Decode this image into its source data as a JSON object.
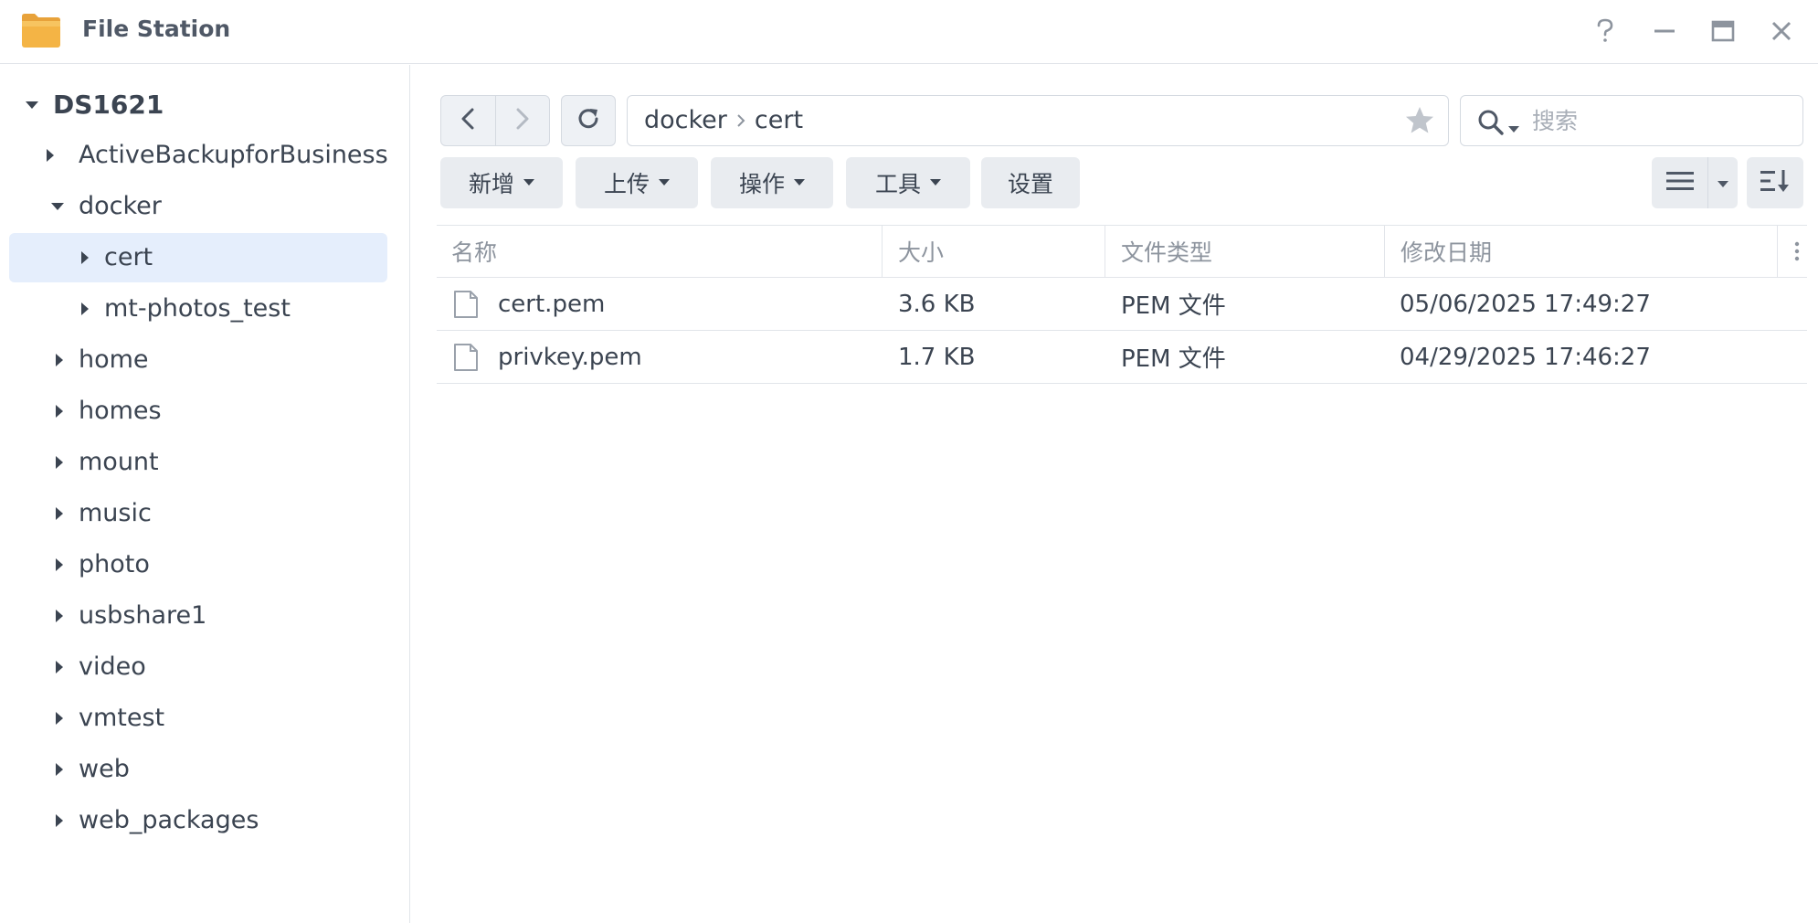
{
  "window": {
    "title": "File Station",
    "accent_color": "#e5eefc"
  },
  "sidebar": {
    "root": "DS1621",
    "items": [
      {
        "label": "ActiveBackupforBusiness",
        "expanded": false
      },
      {
        "label": "docker",
        "expanded": true
      },
      {
        "label": "cert",
        "expanded": false,
        "selected": true
      },
      {
        "label": "mt-photos_test",
        "expanded": false
      },
      {
        "label": "home",
        "expanded": false
      },
      {
        "label": "homes",
        "expanded": false
      },
      {
        "label": "mount",
        "expanded": false
      },
      {
        "label": "music",
        "expanded": false
      },
      {
        "label": "photo",
        "expanded": false
      },
      {
        "label": "usbshare1",
        "expanded": false
      },
      {
        "label": "video",
        "expanded": false
      },
      {
        "label": "vmtest",
        "expanded": false
      },
      {
        "label": "web",
        "expanded": false
      },
      {
        "label": "web_packages",
        "expanded": false
      }
    ]
  },
  "pathbar": {
    "crumbs": [
      "docker",
      "cert"
    ]
  },
  "search": {
    "placeholder": "搜索",
    "value": ""
  },
  "toolbar": {
    "new_label": "新增",
    "upload_label": "上传",
    "action_label": "操作",
    "tools_label": "工具",
    "settings_label": "设置"
  },
  "table": {
    "columns": [
      "名称",
      "大小",
      "文件类型",
      "修改日期"
    ],
    "rows": [
      {
        "name": "cert.pem",
        "size": "3.6 KB",
        "type": "PEM 文件",
        "modified": "05/06/2025 17:49:27"
      },
      {
        "name": "privkey.pem",
        "size": "1.7 KB",
        "type": "PEM 文件",
        "modified": "04/29/2025 17:46:27"
      }
    ]
  },
  "icons": {
    "app": "folder-icon",
    "help": "help-icon",
    "minimize": "minimize-icon",
    "maximize": "maximize-icon",
    "close": "close-icon",
    "back": "chevron-left-icon",
    "forward": "chevron-right-icon",
    "refresh": "refresh-icon",
    "favorite": "star-icon",
    "search": "search-icon",
    "view": "list-view-icon",
    "sort": "sort-icon",
    "file": "file-icon"
  }
}
